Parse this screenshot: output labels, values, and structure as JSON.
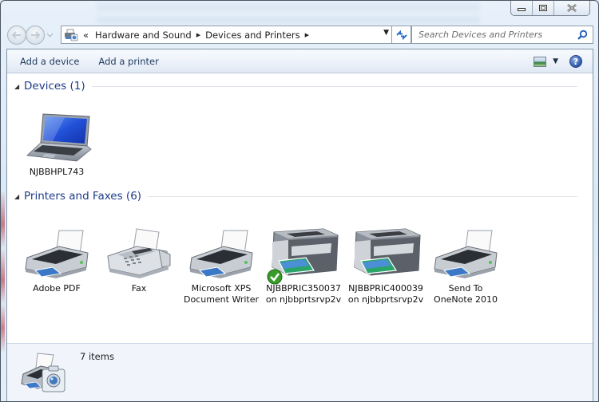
{
  "window": {
    "controls": {
      "minimize": "minimize",
      "maximize": "maximize",
      "close": "close"
    }
  },
  "nav": {
    "back_icon": "back-arrow-icon",
    "forward_icon": "forward-arrow-icon",
    "history_icon": "chevron-down-icon"
  },
  "address": {
    "overflow": "«",
    "breadcrumbs": [
      "Hardware and Sound",
      "Devices and Printers"
    ],
    "icon": "devices-and-printers-icon"
  },
  "search": {
    "placeholder": "Search Devices and Printers",
    "value": ""
  },
  "toolbar": {
    "add_device": "Add a device",
    "add_printer": "Add a printer",
    "view_icon": "change-view-icon",
    "help_icon": "help-icon",
    "help_glyph": "?"
  },
  "groups": [
    {
      "title": "Devices (1)",
      "items": [
        {
          "label": "NJBBHPL743",
          "label2": "",
          "icon": "laptop-icon",
          "default": false
        }
      ]
    },
    {
      "title": "Printers and Faxes (6)",
      "items": [
        {
          "label": "Adobe PDF",
          "label2": "",
          "icon": "printer-icon",
          "default": false
        },
        {
          "label": "Fax",
          "label2": "",
          "icon": "fax-icon",
          "default": false
        },
        {
          "label": "Microsoft XPS",
          "label2": "Document Writer",
          "icon": "printer-icon",
          "default": false
        },
        {
          "label": "NJBBPRIC350037",
          "label2": "on njbbprtsrvp2v",
          "icon": "multifunction-printer-icon",
          "default": true
        },
        {
          "label": "NJBBPRIC400039",
          "label2": "on njbbprtsrvp2v",
          "icon": "multifunction-printer-icon",
          "default": false
        },
        {
          "label": "Send To",
          "label2": "OneNote 2010",
          "icon": "printer-icon",
          "default": false
        }
      ]
    }
  ],
  "status": {
    "count": "7 items",
    "icon": "devices-and-printers-icon"
  },
  "colors": {
    "group_title": "#1e3b8a",
    "command_text": "#1e3a5f",
    "status_bg": "#f1f4fa"
  }
}
